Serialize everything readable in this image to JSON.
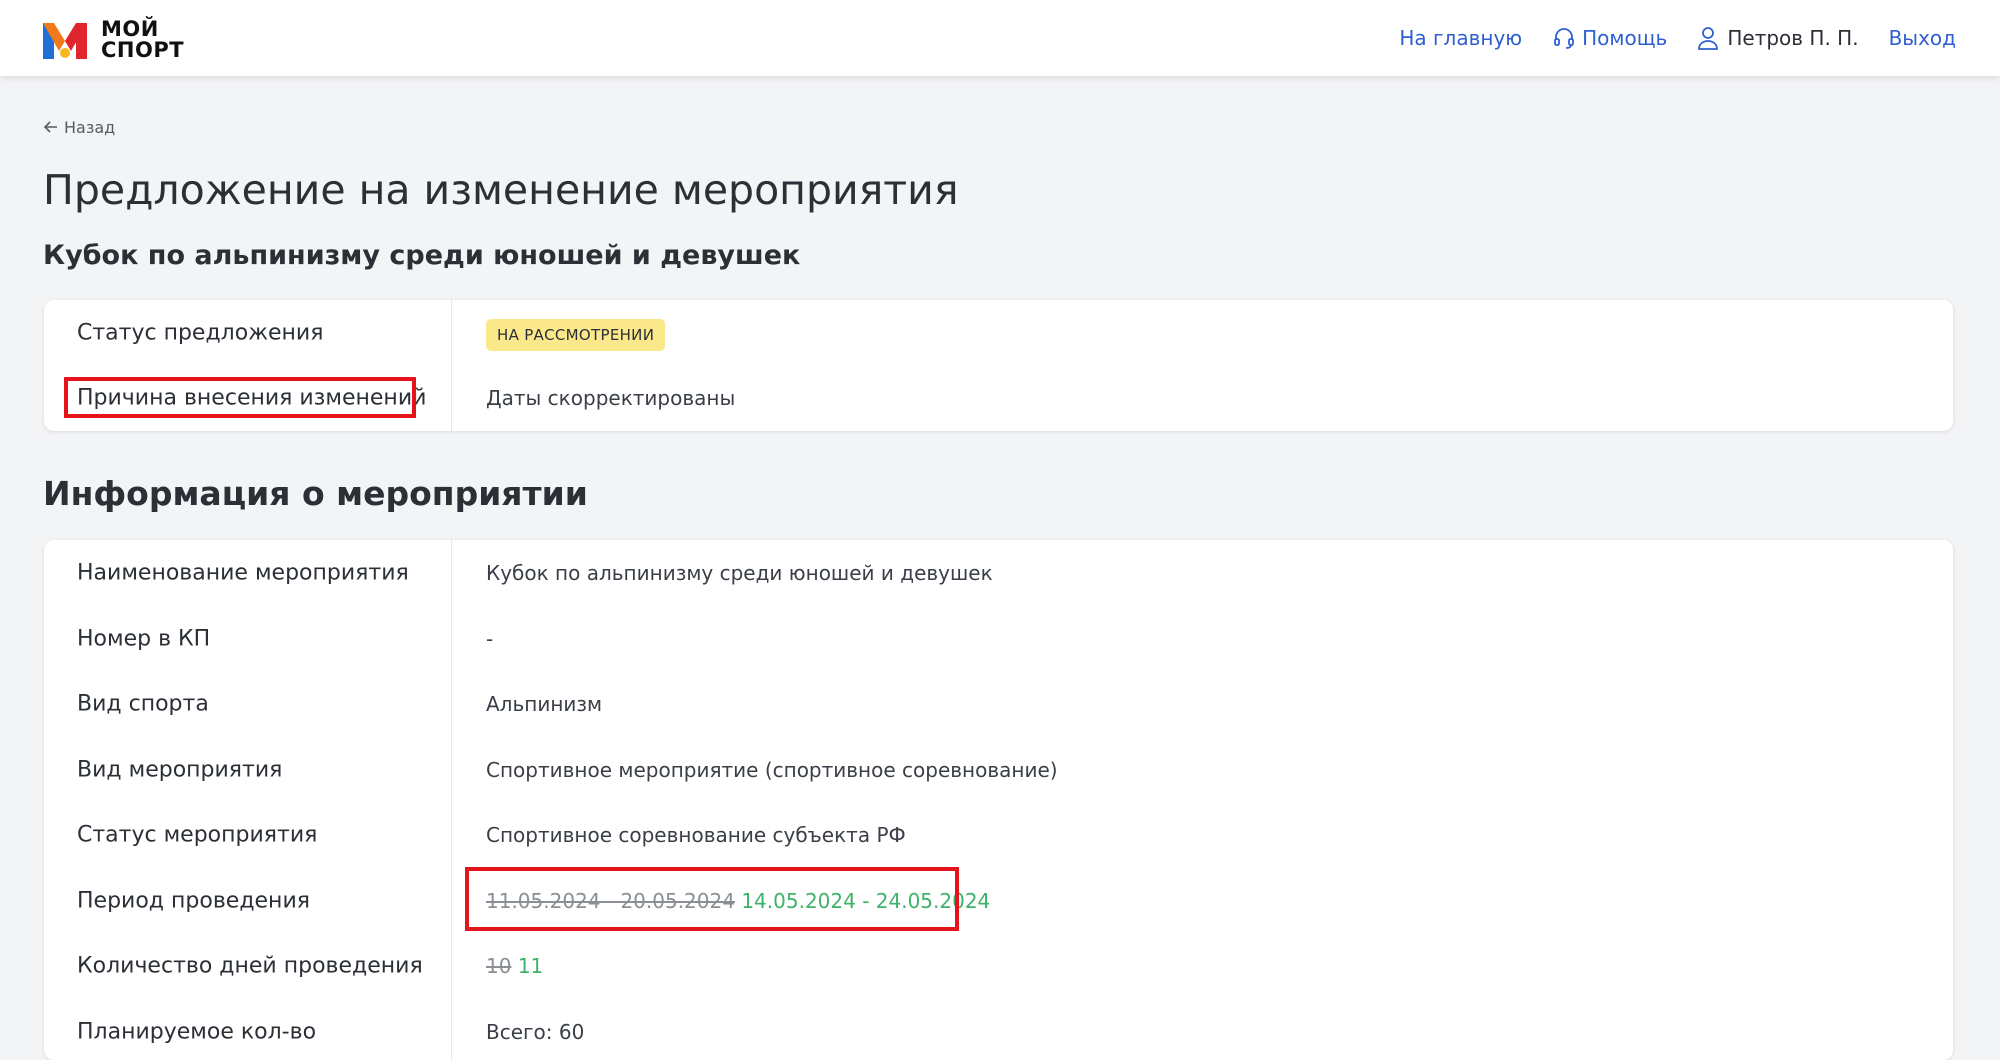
{
  "header": {
    "logo_line1": "МОЙ",
    "logo_line2": "СПОРТ",
    "nav_home": "На главную",
    "nav_help": "Помощь",
    "user_name": "Петров П. П.",
    "logout": "Выход"
  },
  "back_label": "Назад",
  "page_title": "Предложение на изменение мероприятия",
  "subtitle": "Кубок по альпинизму среди юношей и девушек",
  "proposal": {
    "status_label": "Статус предложения",
    "status_value": "НА РАССМОТРЕНИИ",
    "reason_label": "Причина внесения изменений",
    "reason_value": "Даты скорректированы"
  },
  "event_section_title": "Информация о мероприятии",
  "event_info": [
    {
      "label": "Наименование мероприятия",
      "value": "Кубок по альпинизму среди юношей и девушек"
    },
    {
      "label": "Номер в КП",
      "value": "-"
    },
    {
      "label": "Вид спорта",
      "value": "Альпинизм"
    },
    {
      "label": "Вид мероприятия",
      "value": "Спортивное мероприятие (спортивное соревнование)"
    },
    {
      "label": "Статус мероприятия",
      "value": "Спортивное соревнование субъекта РФ"
    }
  ],
  "period": {
    "label": "Период проведения",
    "old_value": "11.05.2024 - 20.05.2024",
    "new_value": "14.05.2024 - 24.05.2024"
  },
  "days": {
    "label": "Количество дней проведения",
    "old_value": "10",
    "new_value": "11"
  },
  "planned": {
    "label": "Планируемое кол-во",
    "value": "Всего: 60"
  },
  "colors": {
    "accent_blue": "#2f5fd0",
    "badge_yellow": "#fbe88a",
    "changed_green": "#3fb26a",
    "highlight_red": "#e3141b"
  }
}
